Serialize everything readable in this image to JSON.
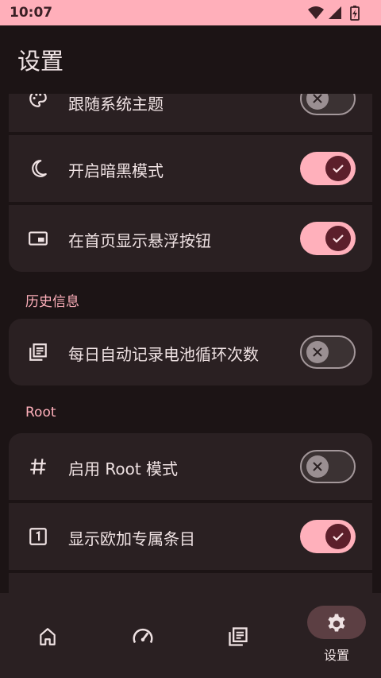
{
  "status": {
    "time": "10:07"
  },
  "appbar": {
    "title": "设置"
  },
  "settings": {
    "follow_system_theme": {
      "label": "跟随系统主题",
      "enabled": false
    },
    "dark_mode": {
      "label": "开启暗黑模式",
      "enabled": true
    },
    "floating_button": {
      "label": "在首页显示悬浮按钮",
      "enabled": true
    },
    "history_section": "历史信息",
    "daily_record": {
      "label": "每日自动记录电池循环次数",
      "enabled": false
    },
    "root_section": "Root",
    "root_mode": {
      "label": "启用 Root 模式",
      "enabled": false
    },
    "oneplus_items": {
      "label": "显示欧加专属条目",
      "enabled": true
    }
  },
  "nav": {
    "items": [
      {
        "icon": "home-icon"
      },
      {
        "icon": "speedometer-icon"
      },
      {
        "icon": "history-list-icon"
      },
      {
        "icon": "gear-icon",
        "label": "设置",
        "selected": true
      }
    ]
  },
  "colors": {
    "accent": "#ffb0bb",
    "surface": "#2a2022",
    "background": "#1c1415"
  }
}
